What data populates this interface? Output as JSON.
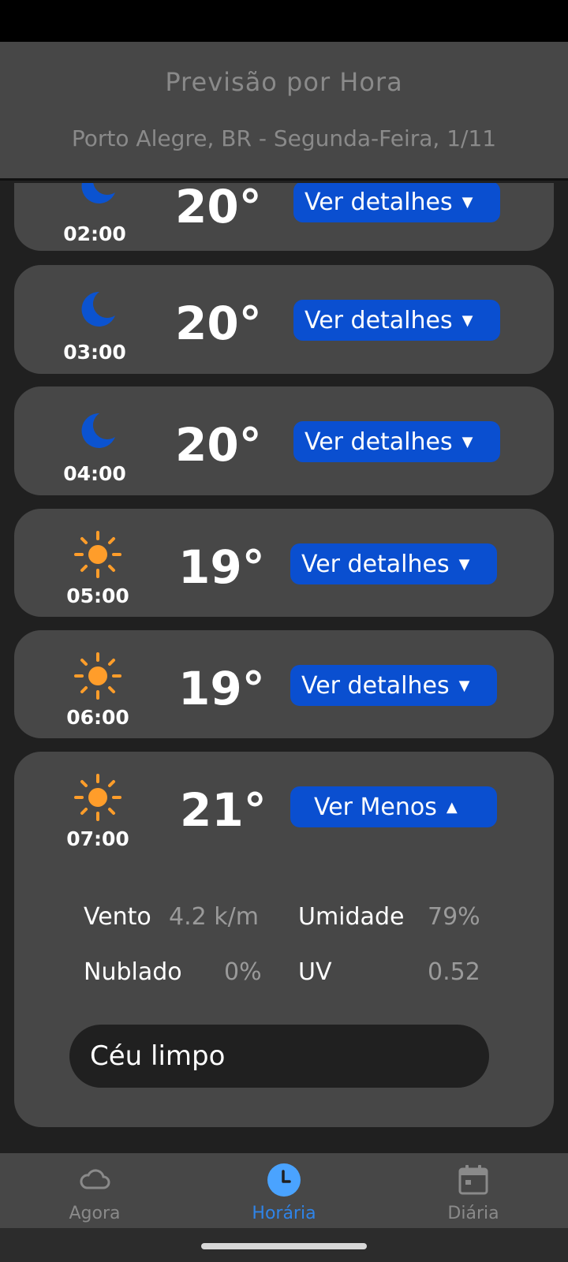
{
  "header": {
    "title": "Previsão por Hora",
    "subtitle": "Porto Alegre, BR - Segunda-Feira, 1/11"
  },
  "hours": [
    {
      "time": "02:00",
      "temp": "20°",
      "icon": "moon-icon",
      "button": "Ver detalhes"
    },
    {
      "time": "03:00",
      "temp": "20°",
      "icon": "moon-icon",
      "button": "Ver detalhes"
    },
    {
      "time": "04:00",
      "temp": "20°",
      "icon": "moon-icon",
      "button": "Ver detalhes"
    },
    {
      "time": "05:00",
      "temp": "19°",
      "icon": "sun-icon",
      "button": "Ver detalhes"
    },
    {
      "time": "06:00",
      "temp": "19°",
      "icon": "sun-icon",
      "button": "Ver detalhes"
    },
    {
      "time": "07:00",
      "temp": "21°",
      "icon": "sun-icon",
      "button": "Ver Menos",
      "details": {
        "wind_label": "Vento",
        "wind_value": "4.2 k/m",
        "humidity_label": "Umidade",
        "humidity_value": "79%",
        "cloud_label": "Nublado",
        "cloud_value": "0%",
        "uv_label": "UV",
        "uv_value": "0.52",
        "description": "Céu limpo"
      }
    }
  ],
  "nav": {
    "now_label": "Agora",
    "hourly_label": "Horária",
    "daily_label": "Diária"
  },
  "colors": {
    "accent": "#0a4fd0",
    "nav_active": "#2f84e8",
    "moon": "#0b53d0",
    "sun": "#ff9d2a"
  }
}
